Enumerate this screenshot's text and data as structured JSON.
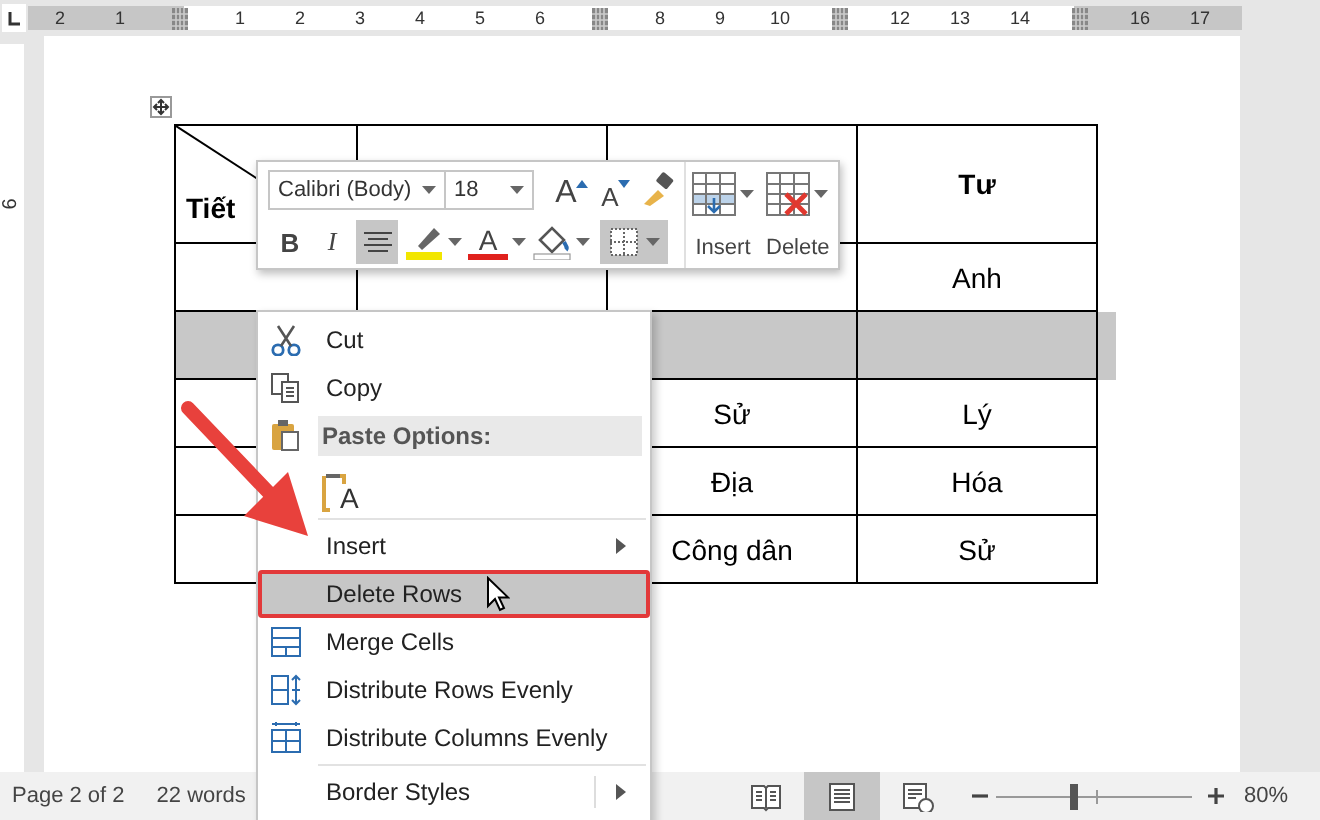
{
  "ruler": {
    "marks": [
      {
        "kind": "number",
        "label": "2"
      },
      {
        "kind": "number",
        "label": "1"
      },
      {
        "kind": "marker"
      },
      {
        "kind": "number",
        "label": "1"
      },
      {
        "kind": "number",
        "label": "2"
      },
      {
        "kind": "number",
        "label": "3"
      },
      {
        "kind": "number",
        "label": "4"
      },
      {
        "kind": "number",
        "label": "5"
      },
      {
        "kind": "number",
        "label": "6"
      },
      {
        "kind": "marker"
      },
      {
        "kind": "number",
        "label": "8"
      },
      {
        "kind": "number",
        "label": "9"
      },
      {
        "kind": "number",
        "label": "10"
      },
      {
        "kind": "marker"
      },
      {
        "kind": "number",
        "label": "12"
      },
      {
        "kind": "number",
        "label": "13"
      },
      {
        "kind": "number",
        "label": "14"
      },
      {
        "kind": "marker"
      },
      {
        "kind": "number",
        "label": "16"
      },
      {
        "kind": "number",
        "label": "17"
      }
    ],
    "side_label": "6"
  },
  "table": {
    "corner": {
      "bottom": "Tiết"
    },
    "header": [
      "Tư"
    ],
    "rows": [
      {
        "selected": false,
        "cells": [
          "Anh"
        ]
      },
      {
        "selected": true
      },
      {
        "selected": false,
        "cells": [
          "Sử",
          "Lý"
        ]
      },
      {
        "selected": false,
        "cells": [
          "Địa",
          "Hóa"
        ]
      },
      {
        "selected": false,
        "cells": [
          "Công dân",
          "Sử"
        ]
      }
    ]
  },
  "mini_toolbar": {
    "font": "Calibri (Body)",
    "size": "18",
    "grow": "A",
    "shrink": "A",
    "bold": "B",
    "italic": "I",
    "font_color": "A",
    "align_selected": true,
    "borders_selected": true,
    "insert_label": "Insert",
    "delete_label": "Delete"
  },
  "context_menu": {
    "items": [
      {
        "kind": "item",
        "label": "Cut",
        "submenu": false,
        "highlighted": false
      },
      {
        "kind": "item",
        "label": "Copy",
        "submenu": false,
        "highlighted": false
      },
      {
        "kind": "header",
        "label": "Paste Options:"
      },
      {
        "kind": "paste",
        "glyph": "A"
      },
      {
        "kind": "separator"
      },
      {
        "kind": "item",
        "label": "Insert",
        "submenu": true,
        "highlighted": false
      },
      {
        "kind": "item",
        "label": "Delete Rows",
        "submenu": false,
        "highlighted": true
      },
      {
        "kind": "item",
        "label": "Merge Cells",
        "submenu": false,
        "highlighted": false
      },
      {
        "kind": "item",
        "label": "Distribute Rows Evenly",
        "submenu": false,
        "highlighted": false
      },
      {
        "kind": "item",
        "label": "Distribute Columns Evenly",
        "submenu": false,
        "highlighted": false
      },
      {
        "kind": "separator"
      },
      {
        "kind": "item",
        "label": "Border Styles",
        "submenu": true,
        "highlighted": false
      }
    ]
  },
  "status_bar": {
    "page": "Page 2 of 2",
    "words": "22 words",
    "views": [
      {
        "selected": false
      },
      {
        "selected": true
      },
      {
        "selected": false
      }
    ],
    "zoom": {
      "level": 0.38,
      "reading": "80%"
    }
  }
}
